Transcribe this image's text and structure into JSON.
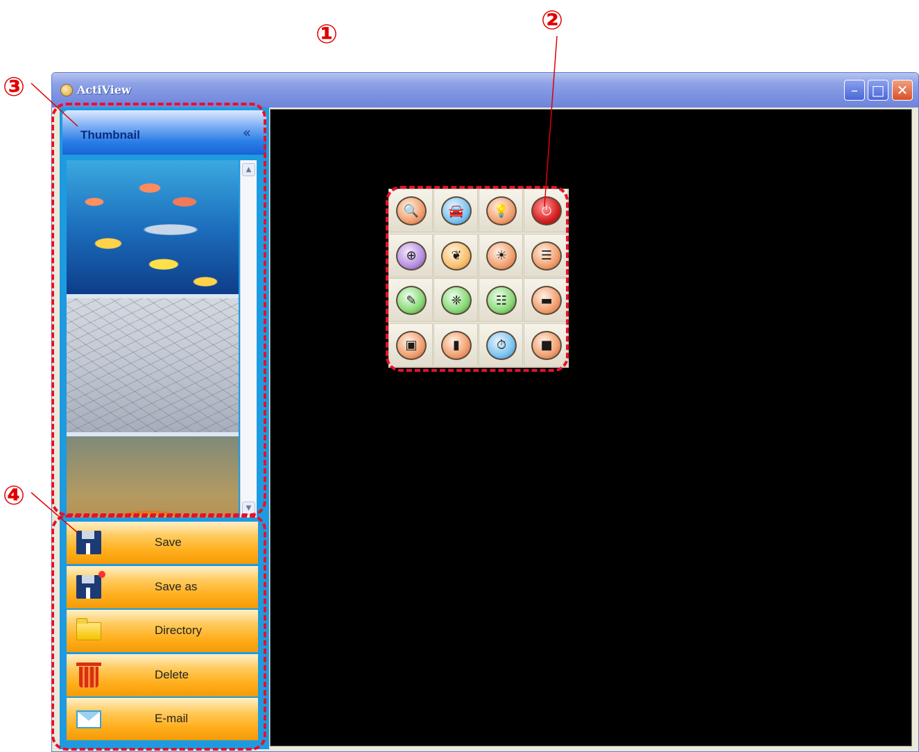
{
  "app": {
    "title": "ActiView"
  },
  "window_controls": {
    "minimize": "–",
    "maximize": "□",
    "close": "✕"
  },
  "callouts": {
    "c1": "①",
    "c2": "②",
    "c3": "③",
    "c4": "④"
  },
  "thumbnail_panel": {
    "title": "Thumbnail",
    "collapse_glyph": "«",
    "scroll_up": "▲",
    "scroll_down": "▼",
    "thumbnails": [
      "fish-underwater",
      "cracked-desert",
      "hot-spring"
    ]
  },
  "actions": [
    {
      "label": "Save",
      "icon": "floppy-disk-icon"
    },
    {
      "label": "Save as",
      "icon": "floppy-disk-new-icon"
    },
    {
      "label": "Directory",
      "icon": "folder-icon"
    },
    {
      "label": "Delete",
      "icon": "trash-icon"
    },
    {
      "label": "E-mail",
      "icon": "envelope-icon"
    }
  ],
  "tools": [
    {
      "icon": "document-zoom-icon",
      "glyph": "🔍",
      "color": "peach"
    },
    {
      "icon": "car-icon",
      "glyph": "🚘",
      "color": "blue"
    },
    {
      "icon": "lightbulb-icon",
      "glyph": "💡",
      "color": "peach"
    },
    {
      "icon": "power-icon",
      "glyph": "⏻",
      "color": "red"
    },
    {
      "icon": "zoom-in-icon",
      "glyph": "⊕",
      "color": "purple"
    },
    {
      "icon": "focus-icon",
      "glyph": "❦",
      "color": "orange"
    },
    {
      "icon": "brightness-icon",
      "glyph": "☀",
      "color": "peach"
    },
    {
      "icon": "clipboard-icon",
      "glyph": "☰",
      "color": "peach"
    },
    {
      "icon": "annotate-icon",
      "glyph": "✎",
      "color": "green"
    },
    {
      "icon": "effect-icon",
      "glyph": "❈",
      "color": "green"
    },
    {
      "icon": "document-icon",
      "glyph": "☷",
      "color": "green"
    },
    {
      "icon": "window-icon",
      "glyph": "▬",
      "color": "peach"
    },
    {
      "icon": "camera-icon",
      "glyph": "▣",
      "color": "peach"
    },
    {
      "icon": "video-camera-icon",
      "glyph": "▮",
      "color": "peach"
    },
    {
      "icon": "timer-icon",
      "glyph": "⏱",
      "color": "blue"
    },
    {
      "icon": "stop-icon",
      "glyph": "■",
      "color": "peach"
    }
  ]
}
